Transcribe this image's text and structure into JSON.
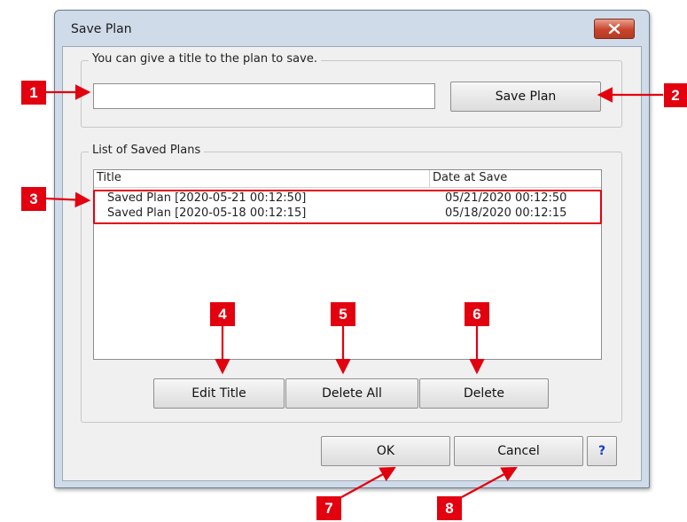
{
  "window": {
    "title": "Save Plan"
  },
  "title_group": {
    "legend": "You can give a title to the plan to save.",
    "input_value": "",
    "save_button": "Save Plan"
  },
  "list_group": {
    "legend": "List of Saved Plans",
    "columns": [
      "Title",
      "Date at Save"
    ],
    "rows": [
      {
        "title": "Saved Plan [2020-05-21 00:12:50]",
        "date": "05/21/2020 00:12:50"
      },
      {
        "title": "Saved Plan [2020-05-18 00:12:15]",
        "date": "05/18/2020 00:12:15"
      }
    ],
    "buttons": {
      "edit_title": "Edit Title",
      "delete_all": "Delete All",
      "delete": "Delete"
    }
  },
  "footer": {
    "ok": "OK",
    "cancel": "Cancel",
    "help": "?"
  },
  "markers": [
    "1",
    "2",
    "3",
    "4",
    "5",
    "6",
    "7",
    "8"
  ],
  "colors": {
    "marker": "#e3000f",
    "titlebar": "#cfdbe9",
    "help": "#1a3cc8"
  }
}
